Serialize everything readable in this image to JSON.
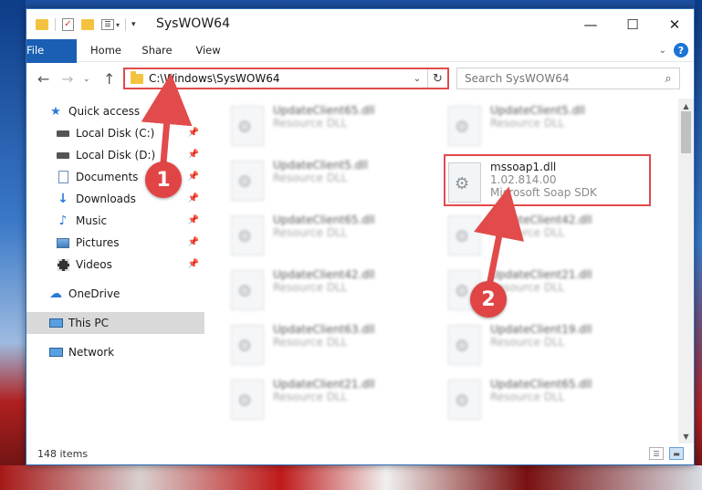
{
  "window": {
    "title": "SysWOW64",
    "minimize": "—",
    "maximize": "☐",
    "close": "✕"
  },
  "ribbon": {
    "tabs": [
      "File",
      "Home",
      "Share",
      "View"
    ]
  },
  "navbar": {
    "address_path": "C:\\Windows\\SysWOW64",
    "search_placeholder": "Search SysWOW64"
  },
  "sidebar": {
    "items": [
      {
        "label": "Quick access",
        "icon": "star-icon",
        "pinned": false
      },
      {
        "label": "Local Disk (C:)",
        "icon": "drive-icon",
        "pinned": true
      },
      {
        "label": "Local Disk (D:)",
        "icon": "drive-icon",
        "pinned": true
      },
      {
        "label": "Documents",
        "icon": "document-icon",
        "pinned": true
      },
      {
        "label": "Downloads",
        "icon": "download-icon",
        "pinned": true
      },
      {
        "label": "Music",
        "icon": "music-icon",
        "pinned": true
      },
      {
        "label": "Pictures",
        "icon": "picture-icon",
        "pinned": true
      },
      {
        "label": "Videos",
        "icon": "video-icon",
        "pinned": true
      },
      {
        "label": "OneDrive",
        "icon": "cloud-icon",
        "pinned": false
      },
      {
        "label": "This PC",
        "icon": "computer-icon",
        "pinned": false
      },
      {
        "label": "Network",
        "icon": "network-icon",
        "pinned": false
      }
    ]
  },
  "files": {
    "left": [
      {
        "name": "UpdateClient65.dll",
        "sub": "Resource DLL"
      },
      {
        "name": "UpdateClient5.dll",
        "sub": "Resource DLL"
      },
      {
        "name": "UpdateClient65.dll",
        "sub": "Resource DLL"
      },
      {
        "name": "UpdateClient42.dll",
        "sub": "Resource DLL"
      },
      {
        "name": "UpdateClient63.dll",
        "sub": "Resource DLL"
      },
      {
        "name": "UpdateClient21.dll",
        "sub": "Resource DLL"
      }
    ],
    "right": [
      {
        "name": "UpdateClient5.dll",
        "sub": "Resource DLL"
      },
      {
        "name": "mssoap1.dll",
        "sub": "1.02.814.00",
        "sub2": "Microsoft Soap SDK"
      },
      {
        "name": "UpdateClient42.dll",
        "sub": "Resource DLL"
      },
      {
        "name": "UpdateClient21.dll",
        "sub": "Resource DLL"
      },
      {
        "name": "UpdateClient19.dll",
        "sub": "Resource DLL"
      },
      {
        "name": "UpdateClient65.dll",
        "sub": "Resource DLL"
      }
    ]
  },
  "status": {
    "item_count": "148 items"
  },
  "annotations": {
    "badge1": "1",
    "badge2": "2",
    "color": "#e24b4b"
  }
}
